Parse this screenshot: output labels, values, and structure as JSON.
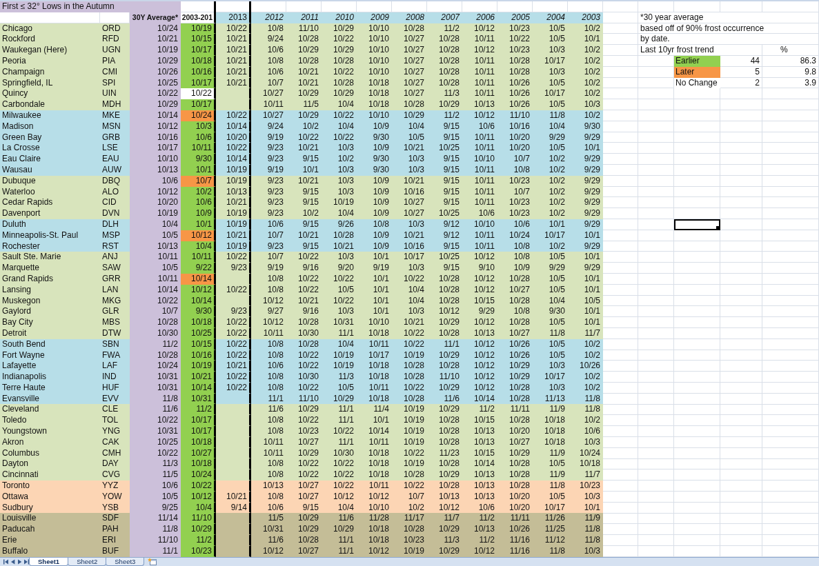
{
  "sheet": {
    "title": "First ≤ 32° Lows in the Autumn",
    "header": {
      "average": "30Y Average*",
      "recent_average": "2003-201",
      "current_year": "2013",
      "past_years": [
        "2012",
        "2011",
        "2010",
        "2009",
        "2008",
        "2007",
        "2006",
        "2005",
        "2004",
        "2003"
      ]
    },
    "groups": [
      {
        "color": "#d8e4bc",
        "stations": [
          {
            "name": "Chicago",
            "code": "ORD",
            "average": "10/24",
            "recent_average": "10/19",
            "color": "#92d050",
            "current": "10/22",
            "past": [
              "10/8",
              "11/10",
              "10/29",
              "10/10",
              "10/28",
              "11/2",
              "10/12",
              "10/23",
              "10/5",
              "10/2"
            ],
            "active_cell": false
          },
          {
            "name": "Rockford",
            "code": "RFD",
            "average": "10/21",
            "recent_average": "10/15",
            "color": "#92d050",
            "current": "10/21",
            "past": [
              "9/24",
              "10/28",
              "10/22",
              "10/10",
              "10/27",
              "10/28",
              "10/11",
              "10/22",
              "10/5",
              "10/1"
            ],
            "active_cell": false
          },
          {
            "name": "Waukegan (Here)",
            "code": "UGN",
            "average": "10/19",
            "recent_average": "10/17",
            "color": "#92d050",
            "current": "10/21",
            "past": [
              "10/6",
              "10/29",
              "10/29",
              "10/10",
              "10/27",
              "10/28",
              "10/12",
              "10/23",
              "10/3",
              "10/2"
            ],
            "active_cell": false
          },
          {
            "name": "Peoria",
            "code": "PIA",
            "average": "10/29",
            "recent_average": "10/18",
            "color": "#92d050",
            "current": "10/21",
            "past": [
              "10/8",
              "10/28",
              "10/28",
              "10/10",
              "10/27",
              "10/28",
              "10/11",
              "10/28",
              "10/17",
              "10/2"
            ],
            "active_cell": false
          },
          {
            "name": "Champaign",
            "code": "CMI",
            "average": "10/26",
            "recent_average": "10/16",
            "color": "#92d050",
            "current": "10/21",
            "past": [
              "10/6",
              "10/21",
              "10/22",
              "10/10",
              "10/27",
              "10/28",
              "10/11",
              "10/28",
              "10/3",
              "10/2"
            ],
            "active_cell": false
          },
          {
            "name": "Springfield, IL",
            "code": "SPI",
            "average": "10/25",
            "recent_average": "10/17",
            "color": "#92d050",
            "current": "10/21",
            "past": [
              "10/7",
              "10/21",
              "10/28",
              "10/18",
              "10/27",
              "10/28",
              "10/11",
              "10/26",
              "10/5",
              "10/2"
            ],
            "active_cell": false
          },
          {
            "name": "Quincy",
            "code": "UIN",
            "average": "10/22",
            "recent_average": "10/22",
            "color": "#ffffff",
            "past": [
              "10/27",
              "10/29",
              "10/29",
              "10/18",
              "10/27",
              "11/3",
              "10/11",
              "10/26",
              "10/17",
              "10/2"
            ],
            "active_cell": false
          },
          {
            "name": "Carbondale",
            "code": "MDH",
            "average": "10/29",
            "recent_average": "10/17",
            "color": "#92d050",
            "past": [
              "10/11",
              "11/5",
              "10/4",
              "10/18",
              "10/28",
              "10/29",
              "10/13",
              "10/26",
              "10/5",
              "10/3"
            ],
            "active_cell": false
          }
        ]
      },
      {
        "color": "#b7dee8",
        "stations": [
          {
            "name": "Milwaukee",
            "code": "MKE",
            "average": "10/14",
            "recent_average": "10/24",
            "color": "#f79646",
            "current": "10/22",
            "past": [
              "10/27",
              "10/29",
              "10/22",
              "10/10",
              "10/29",
              "11/2",
              "10/12",
              "11/10",
              "11/8",
              "10/2"
            ],
            "active_cell": false
          },
          {
            "name": "Madison",
            "code": "MSN",
            "average": "10/12",
            "recent_average": "10/3",
            "color": "#92d050",
            "current": "10/14",
            "past": [
              "9/24",
              "10/2",
              "10/4",
              "10/9",
              "10/4",
              "9/15",
              "10/6",
              "10/16",
              "10/4",
              "9/30"
            ],
            "active_cell": false
          },
          {
            "name": "Green Bay",
            "code": "GRB",
            "average": "10/16",
            "recent_average": "10/6",
            "color": "#92d050",
            "current": "10/20",
            "past": [
              "9/19",
              "10/22",
              "10/22",
              "9/30",
              "10/5",
              "9/15",
              "10/11",
              "10/20",
              "9/29",
              "9/29"
            ],
            "active_cell": false
          },
          {
            "name": "La Crosse",
            "code": "LSE",
            "average": "10/17",
            "recent_average": "10/11",
            "color": "#92d050",
            "current": "10/22",
            "past": [
              "9/23",
              "10/21",
              "10/3",
              "10/9",
              "10/21",
              "10/25",
              "10/11",
              "10/20",
              "10/5",
              "10/1"
            ],
            "active_cell": false
          },
          {
            "name": "Eau Claire",
            "code": "EAU",
            "average": "10/10",
            "recent_average": "9/30",
            "color": "#92d050",
            "current": "10/14",
            "past": [
              "9/23",
              "9/15",
              "10/2",
              "9/30",
              "10/3",
              "9/15",
              "10/10",
              "10/7",
              "10/2",
              "9/29"
            ],
            "active_cell": false
          },
          {
            "name": "Wausau",
            "code": "AUW",
            "average": "10/13",
            "recent_average": "10/1",
            "color": "#92d050",
            "current": "10/19",
            "past": [
              "9/19",
              "10/1",
              "10/3",
              "9/30",
              "10/3",
              "9/15",
              "10/11",
              "10/8",
              "10/2",
              "9/29"
            ],
            "active_cell": false
          }
        ]
      },
      {
        "color": "#d8e4bc",
        "stations": [
          {
            "name": "Dubuque",
            "code": "DBQ",
            "average": "10/6",
            "recent_average": "10/7",
            "color": "#f79646",
            "current": "10/19",
            "past": [
              "9/23",
              "10/21",
              "10/3",
              "10/9",
              "10/21",
              "9/15",
              "10/11",
              "10/23",
              "10/2",
              "9/29"
            ],
            "active_cell": false
          },
          {
            "name": "Waterloo",
            "code": "ALO",
            "average": "10/12",
            "recent_average": "10/2",
            "color": "#92d050",
            "current": "10/13",
            "past": [
              "9/23",
              "9/15",
              "10/3",
              "10/9",
              "10/16",
              "9/15",
              "10/11",
              "10/7",
              "10/2",
              "9/29"
            ],
            "active_cell": false
          },
          {
            "name": "Cedar Rapids",
            "code": "CID",
            "average": "10/20",
            "recent_average": "10/6",
            "color": "#92d050",
            "current": "10/21",
            "past": [
              "9/23",
              "9/15",
              "10/19",
              "10/9",
              "10/27",
              "9/15",
              "10/11",
              "10/23",
              "10/2",
              "9/29"
            ],
            "active_cell": false
          },
          {
            "name": "Davenport",
            "code": "DVN",
            "average": "10/19",
            "recent_average": "10/9",
            "color": "#92d050",
            "current": "10/19",
            "past": [
              "9/23",
              "10/2",
              "10/4",
              "10/9",
              "10/27",
              "10/25",
              "10/6",
              "10/23",
              "10/2",
              "9/29"
            ],
            "active_cell": false
          }
        ]
      },
      {
        "color": "#b7dee8",
        "stations": [
          {
            "name": "Duluth",
            "code": "DLH",
            "average": "10/4",
            "recent_average": "10/1",
            "color": "#92d050",
            "current": "10/19",
            "past": [
              "10/6",
              "9/15",
              "9/26",
              "10/8",
              "10/3",
              "9/12",
              "10/10",
              "10/6",
              "10/1",
              "9/29"
            ],
            "active_cell": true
          },
          {
            "name": "Minneapolis-St. Paul",
            "code": "MSP",
            "average": "10/5",
            "recent_average": "10/12",
            "color": "#f79646",
            "current": "10/21",
            "past": [
              "10/7",
              "10/21",
              "10/28",
              "10/9",
              "10/21",
              "9/12",
              "10/11",
              "10/24",
              "10/17",
              "10/1"
            ],
            "active_cell": false
          },
          {
            "name": "Rochester",
            "code": "RST",
            "average": "10/13",
            "recent_average": "10/4",
            "color": "#92d050",
            "current": "10/19",
            "past": [
              "9/23",
              "9/15",
              "10/21",
              "10/9",
              "10/16",
              "9/15",
              "10/11",
              "10/8",
              "10/2",
              "9/29"
            ],
            "active_cell": false
          }
        ]
      },
      {
        "color": "#d8e4bc",
        "stations": [
          {
            "name": "Sault Ste. Marie",
            "code": "ANJ",
            "average": "10/11",
            "recent_average": "10/11",
            "color": "#92d050",
            "current": "10/22",
            "past": [
              "10/7",
              "10/22",
              "10/3",
              "10/1",
              "10/17",
              "10/25",
              "10/12",
              "10/8",
              "10/5",
              "10/1"
            ],
            "active_cell": false
          },
          {
            "name": "Marquette",
            "code": "SAW",
            "average": "10/5",
            "recent_average": "9/22",
            "color": "#92d050",
            "current": "9/23",
            "past": [
              "9/19",
              "9/16",
              "9/20",
              "9/19",
              "10/3",
              "9/15",
              "9/10",
              "10/9",
              "9/29",
              "9/29"
            ],
            "active_cell": false
          },
          {
            "name": "Grand Rapids",
            "code": "GRR",
            "average": "10/11",
            "recent_average": "10/14",
            "color": "#f79646",
            "past": [
              "10/8",
              "10/22",
              "10/22",
              "10/1",
              "10/22",
              "10/28",
              "10/12",
              "10/28",
              "10/5",
              "10/1"
            ],
            "active_cell": false
          },
          {
            "name": "Lansing",
            "code": "LAN",
            "average": "10/14",
            "recent_average": "10/12",
            "color": "#92d050",
            "current": "10/22",
            "past": [
              "10/8",
              "10/22",
              "10/5",
              "10/1",
              "10/4",
              "10/28",
              "10/12",
              "10/27",
              "10/5",
              "10/1"
            ],
            "active_cell": false
          },
          {
            "name": "Muskegon",
            "code": "MKG",
            "average": "10/22",
            "recent_average": "10/14",
            "color": "#92d050",
            "past": [
              "10/12",
              "10/21",
              "10/22",
              "10/1",
              "10/4",
              "10/28",
              "10/15",
              "10/28",
              "10/4",
              "10/5"
            ],
            "active_cell": false
          },
          {
            "name": "Gaylord",
            "code": "GLR",
            "average": "10/7",
            "recent_average": "9/30",
            "color": "#92d050",
            "current": "9/23",
            "past": [
              "9/27",
              "9/16",
              "10/3",
              "10/1",
              "10/3",
              "10/12",
              "9/29",
              "10/8",
              "9/30",
              "10/1"
            ],
            "active_cell": false
          },
          {
            "name": "Bay City",
            "code": "MBS",
            "average": "10/28",
            "recent_average": "10/18",
            "color": "#92d050",
            "current": "10/22",
            "past": [
              "10/12",
              "10/28",
              "10/31",
              "10/10",
              "10/21",
              "10/29",
              "10/12",
              "10/28",
              "10/5",
              "10/1"
            ],
            "active_cell": false
          },
          {
            "name": "Detroit",
            "code": "DTW",
            "average": "10/30",
            "recent_average": "10/25",
            "color": "#92d050",
            "current": "10/22",
            "past": [
              "10/11",
              "10/30",
              "11/1",
              "10/18",
              "10/22",
              "10/28",
              "10/13",
              "10/27",
              "11/8",
              "11/7"
            ],
            "active_cell": false
          }
        ]
      },
      {
        "color": "#b7dee8",
        "stations": [
          {
            "name": "South Bend",
            "code": "SBN",
            "average": "11/2",
            "recent_average": "10/15",
            "color": "#92d050",
            "current": "10/22",
            "past": [
              "10/8",
              "10/28",
              "10/4",
              "10/11",
              "10/22",
              "11/1",
              "10/12",
              "10/26",
              "10/5",
              "10/2"
            ],
            "active_cell": false
          },
          {
            "name": "Fort Wayne",
            "code": "FWA",
            "average": "10/28",
            "recent_average": "10/16",
            "color": "#92d050",
            "current": "10/22",
            "past": [
              "10/8",
              "10/22",
              "10/19",
              "10/17",
              "10/19",
              "10/29",
              "10/12",
              "10/26",
              "10/5",
              "10/2"
            ],
            "active_cell": false
          },
          {
            "name": "Lafayette",
            "code": "LAF",
            "average": "10/24",
            "recent_average": "10/19",
            "color": "#92d050",
            "current": "10/21",
            "past": [
              "10/6",
              "10/22",
              "10/19",
              "10/18",
              "10/28",
              "10/28",
              "10/12",
              "10/29",
              "10/3",
              "10/26"
            ],
            "active_cell": false
          },
          {
            "name": "Indianapolis",
            "code": "IND",
            "average": "10/31",
            "recent_average": "10/21",
            "color": "#92d050",
            "current": "10/22",
            "past": [
              "10/8",
              "10/30",
              "11/3",
              "10/18",
              "10/28",
              "11/10",
              "10/12",
              "10/29",
              "10/17",
              "10/2"
            ],
            "active_cell": false
          },
          {
            "name": "Terre Haute",
            "code": "HUF",
            "average": "10/31",
            "recent_average": "10/14",
            "color": "#92d050",
            "current": "10/22",
            "past": [
              "10/8",
              "10/22",
              "10/5",
              "10/11",
              "10/22",
              "10/29",
              "10/12",
              "10/28",
              "10/3",
              "10/2"
            ],
            "active_cell": false
          },
          {
            "name": "Evansville",
            "code": "EVV",
            "average": "11/8",
            "recent_average": "10/31",
            "color": "#92d050",
            "past": [
              "11/1",
              "11/10",
              "10/29",
              "10/18",
              "10/28",
              "11/6",
              "10/14",
              "10/28",
              "11/13",
              "11/8"
            ],
            "active_cell": false
          }
        ]
      },
      {
        "color": "#d8e4bc",
        "stations": [
          {
            "name": "Cleveland",
            "code": "CLE",
            "average": "11/6",
            "recent_average": "11/2",
            "color": "#92d050",
            "past": [
              "11/6",
              "10/29",
              "11/1",
              "11/4",
              "10/19",
              "10/29",
              "11/2",
              "11/11",
              "11/9",
              "11/8"
            ],
            "active_cell": false
          },
          {
            "name": "Toledo",
            "code": "TOL",
            "average": "10/22",
            "recent_average": "10/17",
            "color": "#92d050",
            "past": [
              "10/8",
              "10/22",
              "11/1",
              "10/1",
              "10/19",
              "10/28",
              "10/15",
              "10/28",
              "10/18",
              "10/2"
            ],
            "active_cell": false
          },
          {
            "name": "Youngstown",
            "code": "YNG",
            "average": "10/31",
            "recent_average": "10/17",
            "color": "#92d050",
            "past": [
              "10/8",
              "10/23",
              "10/22",
              "10/14",
              "10/19",
              "10/28",
              "10/13",
              "10/20",
              "10/18",
              "10/6"
            ],
            "active_cell": false
          },
          {
            "name": "Akron",
            "code": "CAK",
            "average": "10/25",
            "recent_average": "10/18",
            "color": "#92d050",
            "past": [
              "10/11",
              "10/27",
              "11/1",
              "10/11",
              "10/19",
              "10/28",
              "10/13",
              "10/27",
              "10/18",
              "10/3"
            ],
            "active_cell": false
          },
          {
            "name": "Columbus",
            "code": "CMH",
            "average": "10/22",
            "recent_average": "10/27",
            "color": "#92d050",
            "past": [
              "10/11",
              "10/29",
              "10/30",
              "10/18",
              "10/22",
              "11/23",
              "10/15",
              "10/29",
              "11/9",
              "10/24"
            ],
            "active_cell": false
          },
          {
            "name": "Dayton",
            "code": "DAY",
            "average": "11/3",
            "recent_average": "10/18",
            "color": "#92d050",
            "past": [
              "10/8",
              "10/22",
              "10/22",
              "10/18",
              "10/19",
              "10/28",
              "10/14",
              "10/28",
              "10/5",
              "10/18"
            ],
            "active_cell": false
          },
          {
            "name": "Cincinnati",
            "code": "CVG",
            "average": "11/5",
            "recent_average": "10/24",
            "color": "#92d050",
            "past": [
              "10/8",
              "10/22",
              "10/22",
              "10/18",
              "10/28",
              "10/29",
              "10/13",
              "10/28",
              "11/9",
              "11/7"
            ],
            "active_cell": false
          }
        ]
      },
      {
        "color": "#fcd5b4",
        "stations": [
          {
            "name": "Toronto",
            "code": "YYZ",
            "average": "10/6",
            "recent_average": "10/22",
            "color": "#92d050",
            "past": [
              "10/13",
              "10/27",
              "10/22",
              "10/11",
              "10/22",
              "10/28",
              "10/13",
              "10/28",
              "11/8",
              "10/23"
            ],
            "active_cell": false
          },
          {
            "name": "Ottawa",
            "code": "YOW",
            "average": "10/5",
            "recent_average": "10/12",
            "color": "#92d050",
            "current": "10/21",
            "past": [
              "10/8",
              "10/27",
              "10/12",
              "10/12",
              "10/7",
              "10/13",
              "10/13",
              "10/20",
              "10/5",
              "10/3"
            ],
            "active_cell": false
          },
          {
            "name": "Sudbury",
            "code": "YSB",
            "average": "9/25",
            "recent_average": "10/4",
            "color": "#92d050",
            "current": "9/14",
            "past": [
              "10/6",
              "9/15",
              "10/4",
              "10/10",
              "10/2",
              "10/12",
              "10/6",
              "10/20",
              "10/17",
              "10/1"
            ],
            "active_cell": false
          }
        ]
      },
      {
        "color": "#c4bd97",
        "stations": [
          {
            "name": "Louisville",
            "code": "SDF",
            "average": "11/14",
            "recent_average": "11/10",
            "color": "#92d050",
            "past": [
              "11/5",
              "10/29",
              "11/6",
              "11/28",
              "11/17",
              "11/7",
              "11/2",
              "11/11",
              "11/26",
              "11/9"
            ],
            "active_cell": false
          },
          {
            "name": "Paducah",
            "code": "PAH",
            "average": "11/8",
            "recent_average": "10/29",
            "color": "#92d050",
            "past": [
              "10/31",
              "10/29",
              "10/29",
              "10/18",
              "10/28",
              "10/29",
              "10/13",
              "10/26",
              "11/25",
              "11/8"
            ],
            "active_cell": false
          },
          {
            "name": "Erie",
            "code": "ERI",
            "average": "11/10",
            "recent_average": "11/2",
            "color": "#92d050",
            "past": [
              "11/6",
              "10/28",
              "11/1",
              "10/18",
              "10/23",
              "11/3",
              "11/2",
              "11/16",
              "11/12",
              "11/8"
            ],
            "active_cell": false
          },
          {
            "name": "Buffalo",
            "code": "BUF",
            "average": "11/1",
            "recent_average": "10/23",
            "color": "#92d050",
            "past": [
              "10/12",
              "10/27",
              "11/1",
              "10/12",
              "10/19",
              "10/29",
              "10/12",
              "11/16",
              "11/8",
              "10/3"
            ],
            "active_cell": false
          }
        ]
      }
    ]
  },
  "side_panel": {
    "notes": [
      "*30 year average",
      "based off of 90% frost occurrence",
      "by date."
    ],
    "title": "Last 10yr frost trend",
    "percent_header": "%",
    "trends": [
      {
        "color": "#92d050",
        "label": "Earlier",
        "count": "44",
        "percent": "86.3"
      },
      {
        "color": "#f79646",
        "label": "Later",
        "count": "5",
        "percent": "9.8"
      },
      {
        "color": "#ffffff",
        "label": "No Change",
        "count": "2",
        "percent": "3.9"
      }
    ]
  },
  "sheet_tabs": [
    {
      "label": "Sheet1",
      "selected": true
    },
    {
      "label": "Sheet2",
      "selected": false
    },
    {
      "label": "Sheet3",
      "selected": false
    }
  ]
}
